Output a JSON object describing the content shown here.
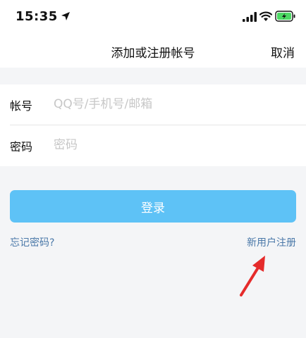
{
  "status_bar": {
    "time": "15:35",
    "icons": [
      "location-arrow-icon",
      "signal-icon",
      "wifi-icon",
      "battery-charging-icon"
    ]
  },
  "nav": {
    "title": "添加或注册帐号",
    "cancel_label": "取消"
  },
  "form": {
    "account_label": "帐号",
    "account_placeholder": "QQ号/手机号/邮箱",
    "account_value": "",
    "password_label": "密码",
    "password_placeholder": "密码",
    "password_value": ""
  },
  "actions": {
    "login_label": "登录",
    "forgot_label": "忘记密码?",
    "register_label": "新用户注册"
  },
  "colors": {
    "accent": "#5ec2f6",
    "link": "#4a78a8",
    "annotation": "#e52b2b",
    "battery": "#4cd964"
  }
}
